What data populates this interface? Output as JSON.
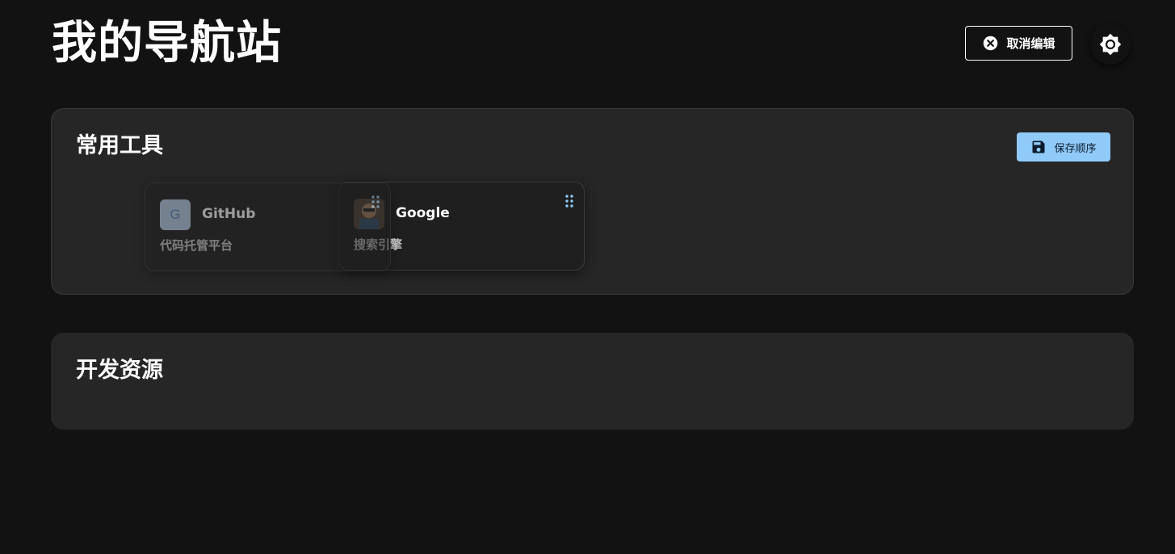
{
  "header": {
    "title": "我的导航站",
    "cancel_edit_label": "取消编辑",
    "cancel_icon": "close-circle-icon",
    "theme_icon": "brightness-icon"
  },
  "colors": {
    "background": "#121212",
    "section_bg": "#262626",
    "card_bg": "#1f1f1f",
    "accent": "#90caf9"
  },
  "sections": [
    {
      "title": "常用工具",
      "save_order_label": "保存顺序",
      "save_icon": "floppy-disk-icon",
      "links": [
        {
          "name": "Google",
          "description": "搜索引擎",
          "icon": "google-favicon",
          "drag_icon": "drag-handle-icon"
        },
        {
          "name": "GitHub",
          "description": "代码托管平台",
          "icon_letter": "G",
          "drag_icon": "drag-handle-icon",
          "state": "dragging"
        }
      ]
    },
    {
      "title": "开发资源",
      "links": []
    }
  ]
}
